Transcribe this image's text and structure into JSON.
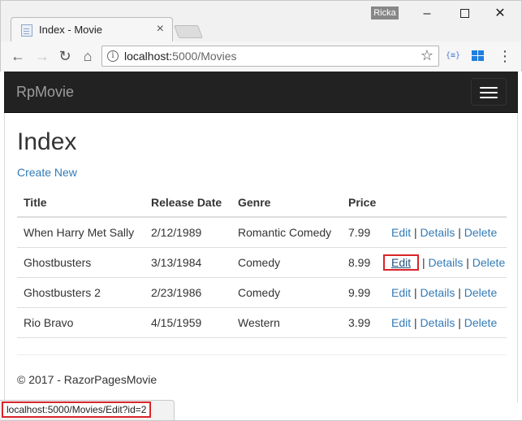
{
  "browser": {
    "tab_title": "Index - Movie",
    "tab_close": "×",
    "user_badge": "Ricka",
    "url_host": "localhost:",
    "url_path": "5000/Movies",
    "ext_label": "{≡}",
    "status_url": "localhost:5000/Movies/Edit?id=2"
  },
  "navbar": {
    "brand": "RpMovie"
  },
  "page": {
    "title": "Index",
    "create_new": "Create New",
    "footer": "© 2017 - RazorPagesMovie"
  },
  "table": {
    "headers": [
      "Title",
      "Release Date",
      "Genre",
      "Price"
    ],
    "rows": [
      {
        "title": "When Harry Met Sally",
        "release_date": "2/12/1989",
        "genre": "Romantic Comedy",
        "price": "7.99"
      },
      {
        "title": "Ghostbusters",
        "release_date": "3/13/1984",
        "genre": "Comedy",
        "price": "8.99"
      },
      {
        "title": "Ghostbusters 2",
        "release_date": "2/23/1986",
        "genre": "Comedy",
        "price": "9.99"
      },
      {
        "title": "Rio Bravo",
        "release_date": "4/15/1959",
        "genre": "Western",
        "price": "3.99"
      }
    ],
    "actions": {
      "edit": "Edit",
      "details": "Details",
      "delete": "Delete",
      "separator": "|"
    }
  },
  "colors": {
    "link": "#337ab7",
    "navbar": "#222222",
    "highlight": "#d9252a"
  }
}
